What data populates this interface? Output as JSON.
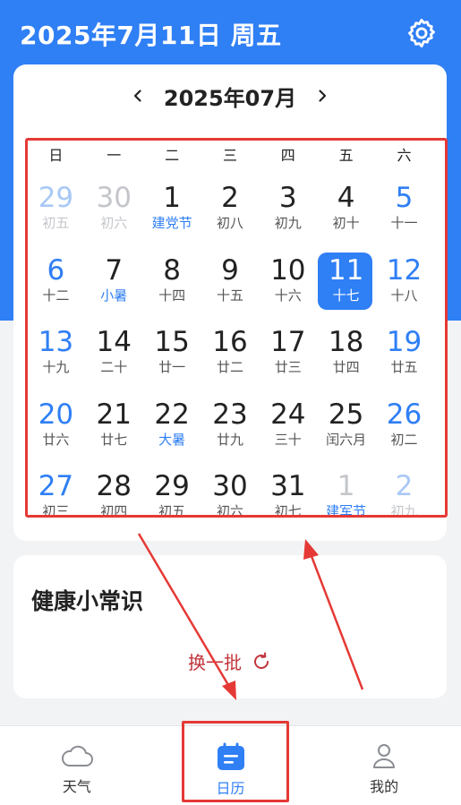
{
  "header": {
    "title": "2025年7月11日 周五"
  },
  "calendar": {
    "month_title": "2025年07月",
    "weekdays": [
      "日",
      "一",
      "二",
      "三",
      "四",
      "五",
      "六"
    ],
    "days": [
      {
        "num": "29",
        "lunar": "初五",
        "other": true,
        "weekend": true
      },
      {
        "num": "30",
        "lunar": "初六",
        "other": true
      },
      {
        "num": "1",
        "lunar": "建党节",
        "festival": true
      },
      {
        "num": "2",
        "lunar": "初八"
      },
      {
        "num": "3",
        "lunar": "初九"
      },
      {
        "num": "4",
        "lunar": "初十"
      },
      {
        "num": "5",
        "lunar": "十一",
        "weekend": true
      },
      {
        "num": "6",
        "lunar": "十二",
        "weekend": true
      },
      {
        "num": "7",
        "lunar": "小暑",
        "festival": true
      },
      {
        "num": "8",
        "lunar": "十四"
      },
      {
        "num": "9",
        "lunar": "十五"
      },
      {
        "num": "10",
        "lunar": "十六"
      },
      {
        "num": "11",
        "lunar": "十七",
        "selected": true
      },
      {
        "num": "12",
        "lunar": "十八",
        "weekend": true
      },
      {
        "num": "13",
        "lunar": "十九",
        "weekend": true
      },
      {
        "num": "14",
        "lunar": "二十"
      },
      {
        "num": "15",
        "lunar": "廿一"
      },
      {
        "num": "16",
        "lunar": "廿二"
      },
      {
        "num": "17",
        "lunar": "廿三"
      },
      {
        "num": "18",
        "lunar": "廿四"
      },
      {
        "num": "19",
        "lunar": "廿五",
        "weekend": true
      },
      {
        "num": "20",
        "lunar": "廿六",
        "weekend": true
      },
      {
        "num": "21",
        "lunar": "廿七"
      },
      {
        "num": "22",
        "lunar": "大暑",
        "festival": true
      },
      {
        "num": "23",
        "lunar": "廿九"
      },
      {
        "num": "24",
        "lunar": "三十"
      },
      {
        "num": "25",
        "lunar": "闰六月"
      },
      {
        "num": "26",
        "lunar": "初二",
        "weekend": true
      },
      {
        "num": "27",
        "lunar": "初三",
        "weekend": true
      },
      {
        "num": "28",
        "lunar": "初四"
      },
      {
        "num": "29",
        "lunar": "初五"
      },
      {
        "num": "30",
        "lunar": "初六"
      },
      {
        "num": "31",
        "lunar": "初七"
      },
      {
        "num": "1",
        "lunar": "建军节",
        "other": true,
        "festival": true
      },
      {
        "num": "2",
        "lunar": "初九",
        "other": true,
        "weekend": true
      }
    ]
  },
  "health": {
    "title": "健康小常识",
    "refresh_label": "换一批"
  },
  "tabs": [
    {
      "label": "天气",
      "icon": "cloud-icon"
    },
    {
      "label": "日历",
      "icon": "calendar-icon",
      "active": true
    },
    {
      "label": "我的",
      "icon": "user-icon"
    }
  ],
  "colors": {
    "primary": "#2f7ff5",
    "highlight": "#e53935",
    "refresh": "#c0353a"
  }
}
